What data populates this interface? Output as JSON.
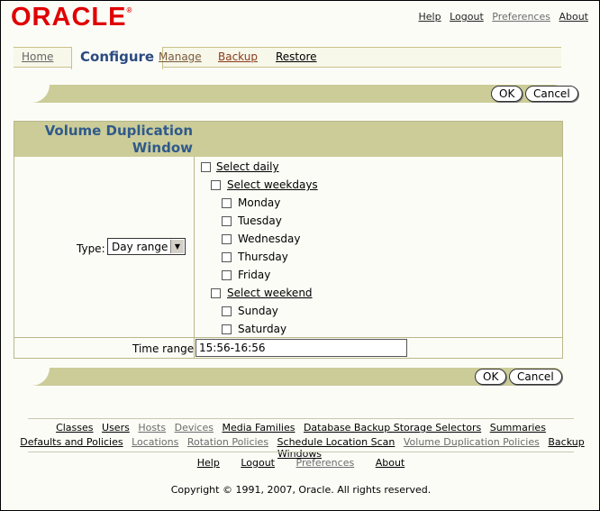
{
  "header": {
    "logo_text": "ORACLE",
    "links": [
      "Help",
      "Logout",
      "Preferences",
      "About"
    ]
  },
  "tabs": [
    "Home",
    "Configure",
    "Manage",
    "Backup",
    "Restore"
  ],
  "buttons": {
    "ok": "OK",
    "cancel": "Cancel"
  },
  "form": {
    "title_line1": "Volume Duplication",
    "title_line2": "Window",
    "type_label": "Type:",
    "type_value": "Day range",
    "checkboxes": {
      "select_daily": "Select daily",
      "select_weekdays": "Select weekdays",
      "monday": "Monday",
      "tuesday": "Tuesday",
      "wednesday": "Wednesday",
      "thursday": "Thursday",
      "friday": "Friday",
      "select_weekend": "Select weekend",
      "sunday": "Sunday",
      "saturday": "Saturday"
    },
    "time_range_label": "Time range",
    "time_range_value": "15:56-16:56"
  },
  "footer": {
    "row1": [
      "Classes",
      "Users",
      "Hosts",
      "Devices",
      "Media Families",
      "Database Backup Storage Selectors",
      "Summaries"
    ],
    "row2": [
      "Defaults and Policies",
      "Locations",
      "Rotation Policies",
      "Schedule Location Scan",
      "Volume Duplication Policies",
      "Backup Windows"
    ],
    "row3": [
      "Help",
      "Logout",
      "Preferences",
      "About"
    ],
    "copyright": "Copyright © 1991, 2007, Oracle. All rights reserved."
  }
}
